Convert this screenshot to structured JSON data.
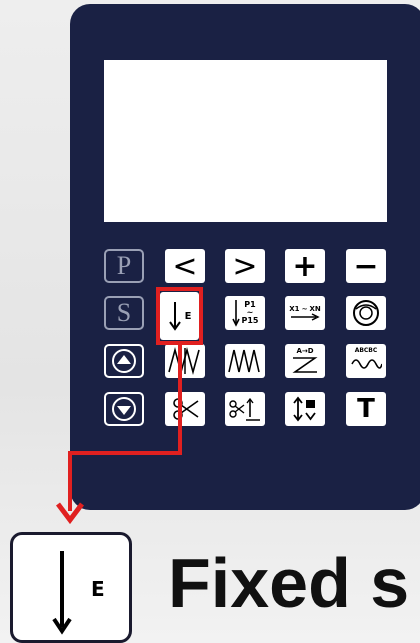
{
  "keys": {
    "p_key": "P",
    "s_key": "S",
    "prev_key": "<",
    "next_key": ">",
    "plus_key": "+",
    "minus_key": "−",
    "end_key_letter": "E",
    "p1_label": "P1",
    "p15_label": "P15",
    "x1_label": "X1",
    "xn_label": "XN",
    "az_label": "A→D",
    "abcbc_label": "ABCBC",
    "t_key": "T"
  },
  "zoom": {
    "key_letter": "E",
    "caption": "Fixed s"
  },
  "colors": {
    "panel": "#1a2144",
    "highlight": "#e02020"
  }
}
